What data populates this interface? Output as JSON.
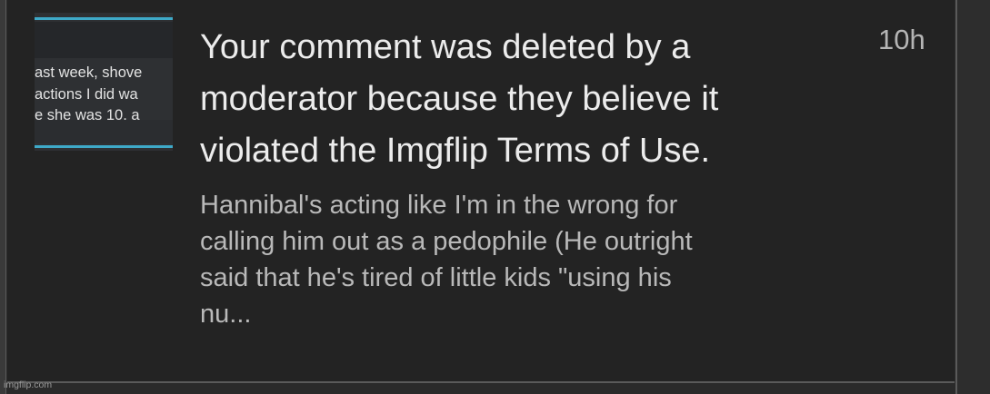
{
  "notification": {
    "thumbnail_lines": [
      "ast week, shove",
      "actions I did wa",
      "e she was 10, a"
    ],
    "title": "Your comment was deleted by a moderator because they believe it violated the Imgflip Terms of Use.",
    "title_lines": [
      "Your comment was deleted by a",
      "moderator because they believe it",
      "violated the Imgflip Terms of Use."
    ],
    "time": "10h",
    "excerpt_lines": [
      "Hannibal's acting like I'm in the wrong for",
      "calling him out as a pedophile (He outright",
      "said that he's tired of little kids \"using his",
      "nu..."
    ]
  },
  "watermark": "imgflip.com"
}
